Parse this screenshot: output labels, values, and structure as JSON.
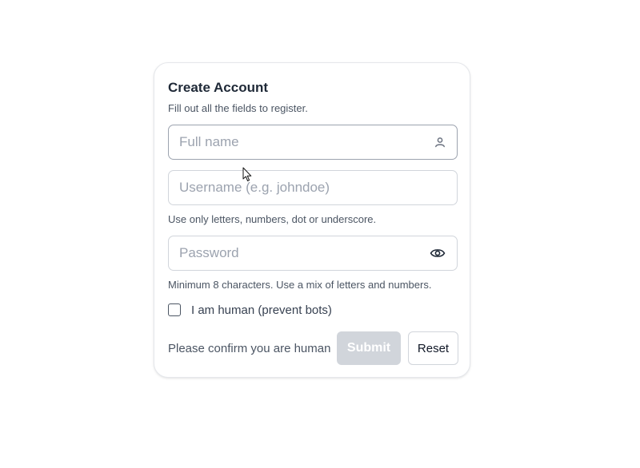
{
  "form": {
    "title": "Create Account",
    "subtitle": "Fill out all the fields to register.",
    "full_name": {
      "placeholder": "Full name",
      "value": "",
      "icon": "user-icon"
    },
    "username": {
      "placeholder": "Username (e.g. johndoe)",
      "value": "",
      "hint": "Use only letters, numbers, dot or underscore."
    },
    "password": {
      "placeholder": "Password",
      "value": "",
      "icon": "eye-icon",
      "hint": "Minimum 8 characters. Use a mix of letters and numbers."
    },
    "captcha": {
      "label": "I am human (prevent bots)",
      "checked": false
    },
    "status_text": "Please confirm you are human",
    "submit_label": "Submit",
    "submit_enabled": false,
    "reset_label": "Reset"
  },
  "colors": {
    "border": "#d1d5db",
    "text_muted": "#4b5563",
    "submit_disabled_bg": "#d1d5db"
  }
}
